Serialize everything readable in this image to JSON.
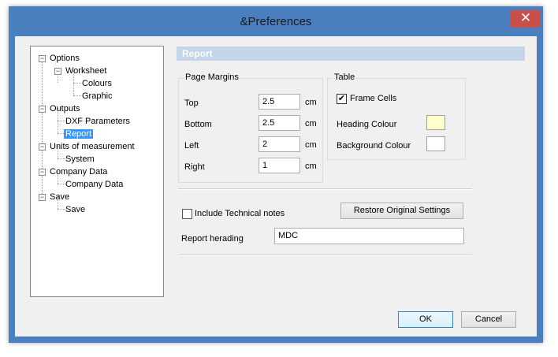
{
  "window": {
    "title": "&Preferences",
    "close_glyph": "✕"
  },
  "tree": {
    "items": [
      {
        "label": "Options"
      },
      {
        "label": "Worksheet"
      },
      {
        "label": "Colours"
      },
      {
        "label": "Graphic"
      },
      {
        "label": "Outputs"
      },
      {
        "label": "DXF Parameters"
      },
      {
        "label": "Report"
      },
      {
        "label": "Units of measurement"
      },
      {
        "label": "System"
      },
      {
        "label": "Company Data"
      },
      {
        "label": "Company Data"
      },
      {
        "label": "Save"
      },
      {
        "label": "Save"
      }
    ],
    "selected": "Report"
  },
  "panel": {
    "title": "Report"
  },
  "margins": {
    "legend": "Page Margins",
    "rows": [
      {
        "label": "Top",
        "value": "2.5",
        "unit": "cm"
      },
      {
        "label": "Bottom",
        "value": "2.5",
        "unit": "cm"
      },
      {
        "label": "Left",
        "value": "2",
        "unit": "cm"
      },
      {
        "label": "Right",
        "value": "1",
        "unit": "cm"
      }
    ]
  },
  "table": {
    "legend": "Table",
    "frame_cells_label": "Frame Cells",
    "frame_cells_checked": true,
    "check_glyph": "✔",
    "heading_colour_label": "Heading Colour",
    "heading_colour": "#ffffcc",
    "background_colour_label": "Background Colour",
    "background_colour": "#ffffff"
  },
  "options": {
    "include_notes_label": "Include Technical notes",
    "include_notes_checked": false,
    "restore_label": "Restore Original Settings",
    "report_heading_label": "Report herading",
    "report_heading_value": "MDC"
  },
  "footer": {
    "ok_label": "OK",
    "cancel_label": "Cancel"
  },
  "icons": {
    "expander_minus": "−"
  }
}
